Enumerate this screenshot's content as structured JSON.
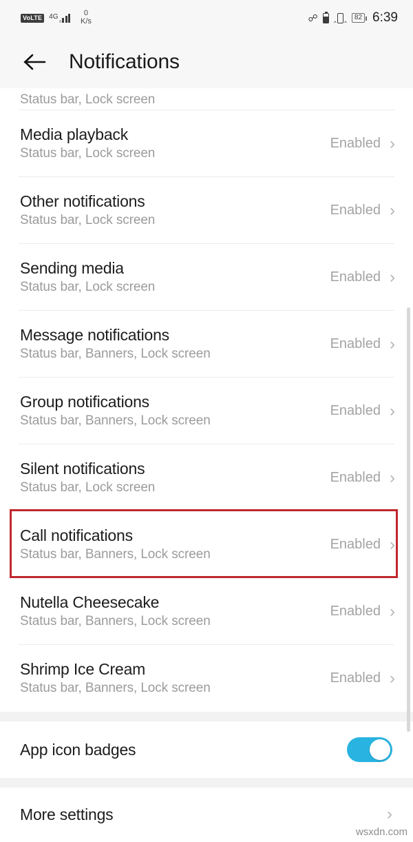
{
  "status_bar": {
    "volte_label": "VoLTE",
    "network_generation": "4G",
    "signal_icon": "signal-bars-icon",
    "data_speed_value": "0",
    "data_speed_unit": "K/s",
    "bluetooth_icon": "bluetooth-icon",
    "headset_battery_icon": "small-battery-icon",
    "vibrate_icon": "vibrate-icon",
    "battery_percent": "82",
    "time": "6:39"
  },
  "header": {
    "back_icon": "back-arrow-icon",
    "title": "Notifications"
  },
  "list": {
    "clipped_top_row": {
      "subtitle": "Status bar, Lock screen"
    },
    "rows": [
      {
        "title": "Media playback",
        "subtitle": "Status bar, Lock screen",
        "value": "Enabled",
        "chevron": "›"
      },
      {
        "title": "Other notifications",
        "subtitle": "Status bar, Lock screen",
        "value": "Enabled",
        "chevron": "›"
      },
      {
        "title": "Sending media",
        "subtitle": "Status bar, Lock screen",
        "value": "Enabled",
        "chevron": "›"
      },
      {
        "title": "Message notifications",
        "subtitle": "Status bar, Banners, Lock screen",
        "value": "Enabled",
        "chevron": "›"
      },
      {
        "title": "Group notifications",
        "subtitle": "Status bar, Banners, Lock screen",
        "value": "Enabled",
        "chevron": "›"
      },
      {
        "title": "Silent notifications",
        "subtitle": "Status bar, Lock screen",
        "value": "Enabled",
        "chevron": "›"
      },
      {
        "title": "Call notifications",
        "subtitle": "Status bar, Banners, Lock screen",
        "value": "Enabled",
        "chevron": "›"
      },
      {
        "title": "Nutella Cheesecake",
        "subtitle": "Status bar, Banners, Lock screen",
        "value": "Enabled",
        "chevron": "›"
      },
      {
        "title": "Shrimp Ice Cream",
        "subtitle": "Status bar, Banners, Lock screen",
        "value": "Enabled",
        "chevron": "›"
      }
    ]
  },
  "app_icon_badges": {
    "label": "App icon badges",
    "toggle_state": "on"
  },
  "more_settings": {
    "label": "More settings",
    "chevron": "›"
  },
  "annotation": {
    "highlight_target": "Call notifications",
    "highlight_color": "#c0272d"
  },
  "watermark": {
    "text": "wsxdn.com"
  },
  "colors": {
    "accent_toggle": "#29b3e0",
    "header_background": "#f7f7f7",
    "divider": "#ececec",
    "section_gap": "#f2f2f2",
    "subtitle_text": "#9b9b9b",
    "value_text": "#a3a3a3"
  }
}
